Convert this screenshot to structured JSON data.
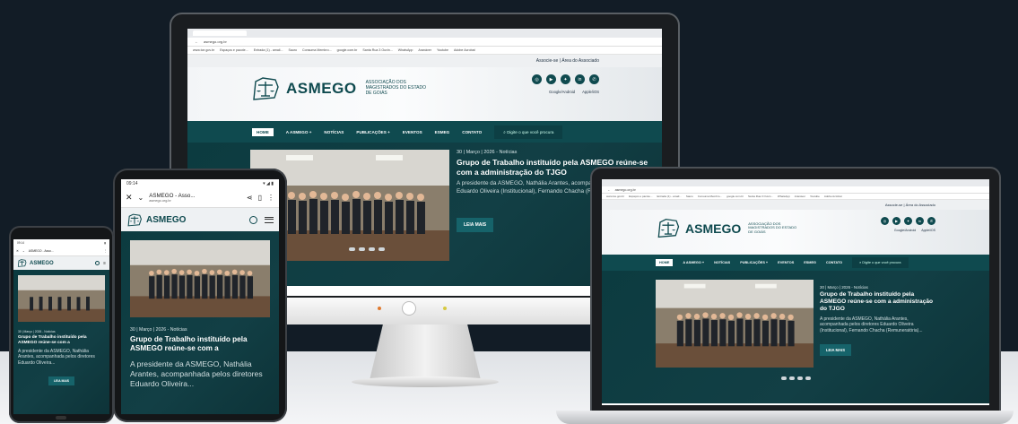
{
  "site": {
    "logo_text": "ASMEGO",
    "logo_sub": "ASSOCIAÇÃO DOS MAGISTRADOS DO ESTADO DE GOIÁS",
    "url": "asmego.org.br",
    "tab_title": "ASMEGO - Asso...",
    "top_link": "Associe-se | Área do Associado",
    "apps": [
      "Google/Android",
      "Apple/iOS"
    ],
    "social_icons": [
      "instagram-icon",
      "youtube-icon",
      "twitter-icon",
      "linkedin-icon",
      "whatsapp-icon"
    ],
    "nav": [
      "HOME",
      "A ASMEGO +",
      "NOTÍCIAS",
      "PUBLICAÇÕES +",
      "EVENTOS",
      "ESMEG",
      "CONTATO"
    ],
    "search_placeholder": "Digite o que você procura",
    "bookmarks": [
      "www.tce.gov.br",
      "Espaços e pacote...",
      "Entrada (1) - amail...",
      "Sauro",
      "Consuma Membro...",
      "google.com.br",
      "Santa Rua 3 Ouvin...",
      "WhatsApp",
      "Aranáver",
      "Youtube",
      "Adobe Acrobat"
    ]
  },
  "news": {
    "meta": "30 | Março | 2026 - Notícias",
    "title": "Grupo de Trabalho instituído pela ASMEGO reúne-se com a administração do TJGO",
    "title_mobile": "Grupo de Trabalho instituído pela ASMEGO reúne-se com a",
    "body": "A presidente da ASMEGO, Nathália Arantes, acompanhada pelos diretores Eduardo Oliveira (Institucional), Fernando Chacha (Remuneratória)...",
    "body_tablet": "A presidente da ASMEGO, Nathália Arantes, acompanhada pelos diretores Eduardo Oliveira...",
    "body_phone": "A presidente da ASMEGO, Nathália Arantes, acompanhada pelos diretores Eduardo Oliveira...",
    "read_more": "LEIA MAIS"
  },
  "status_bar": {
    "time": "09:14",
    "time_small": "09:14"
  },
  "colors": {
    "brand_teal": "#0f4a4f",
    "button": "#16636a",
    "background": "#121c26"
  }
}
